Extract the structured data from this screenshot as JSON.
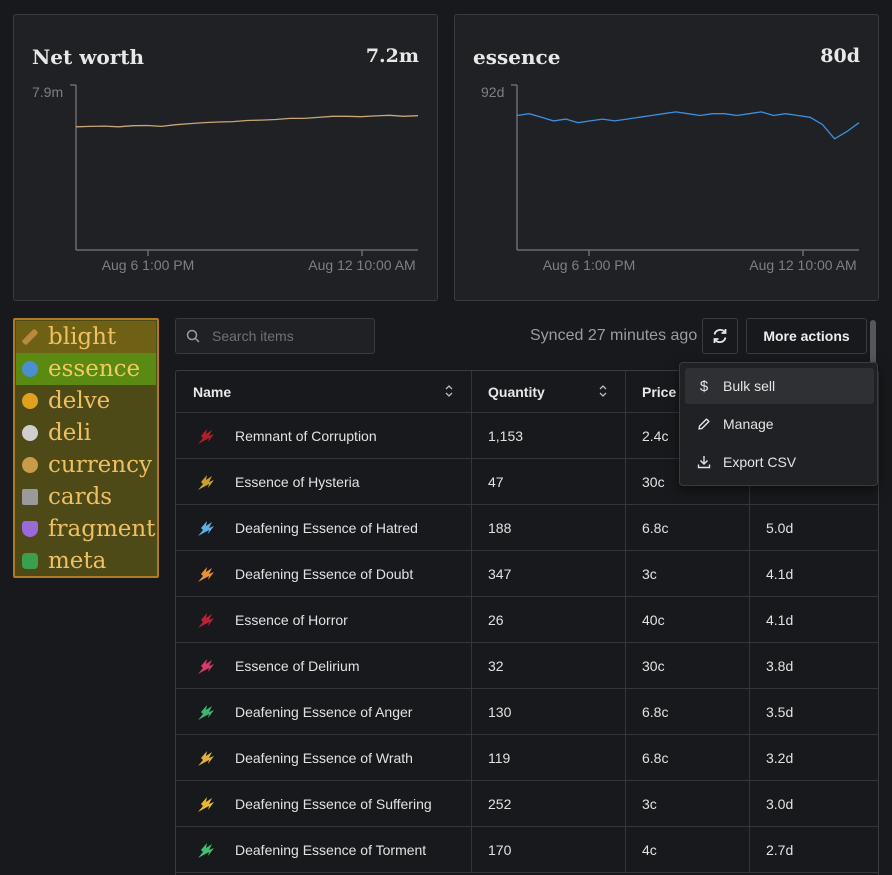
{
  "charts": {
    "networth": {
      "title": "Net worth",
      "value": "7.2m",
      "ytick": "7.9m",
      "xticks": [
        "Aug 6 1:00 PM",
        "Aug 12 10:00 AM"
      ],
      "line_color": "#c9a57a"
    },
    "essence": {
      "title": "essence",
      "value": "80d",
      "ytick": "92d",
      "xticks": [
        "Aug 6 1:00 PM",
        "Aug 12 10:00 AM"
      ],
      "line_color": "#3d8fe0"
    }
  },
  "chart_data": [
    {
      "type": "line",
      "title": "Net worth",
      "ylabel": "",
      "x_ticks": [
        "Aug 6 1:00 PM",
        "Aug 12 10:00 AM"
      ],
      "y_ticks": [
        "7.9m"
      ],
      "ylim": [
        0,
        7.9
      ],
      "series": [
        {
          "values": [
            5.9,
            5.92,
            5.93,
            5.9,
            5.95,
            5.96,
            5.92,
            6.0,
            6.05,
            6.1,
            6.13,
            6.15,
            6.2,
            6.22,
            6.25,
            6.3,
            6.3,
            6.35,
            6.4,
            6.4,
            6.38,
            6.42,
            6.45,
            6.4,
            6.43
          ]
        }
      ]
    },
    {
      "type": "line",
      "title": "essence",
      "ylabel": "",
      "x_ticks": [
        "Aug 6 1:00 PM",
        "Aug 12 10:00 AM"
      ],
      "y_ticks": [
        "92d"
      ],
      "ylim": [
        0,
        92
      ],
      "series": [
        {
          "values": [
            75,
            76,
            74,
            72,
            73,
            71,
            72,
            73,
            72,
            73,
            74,
            75,
            76,
            77,
            76,
            75,
            76,
            76,
            75,
            76,
            77,
            75,
            76,
            75,
            74,
            70,
            62,
            66,
            71
          ]
        }
      ]
    }
  ],
  "categories": [
    {
      "label": "blight",
      "color": "#b88a3a"
    },
    {
      "label": "essence",
      "color": "#4a8fd0"
    },
    {
      "label": "delve",
      "color": "#e0a020"
    },
    {
      "label": "deli",
      "color": "#cfcfcf"
    },
    {
      "label": "currency",
      "color": "#c99a4a"
    },
    {
      "label": "cards",
      "color": "#9a9a9a"
    },
    {
      "label": "fragment",
      "color": "#9b6ad8"
    },
    {
      "label": "meta",
      "color": "#3aa050"
    }
  ],
  "toolbar": {
    "search_placeholder": "Search items",
    "synced": "Synced 27 minutes ago",
    "more_actions": "More actions"
  },
  "menu": {
    "bulk_sell": "Bulk sell",
    "manage": "Manage",
    "export_csv": "Export CSV"
  },
  "table": {
    "headers": {
      "name": "Name",
      "quantity": "Quantity",
      "price": "Price"
    },
    "rows": [
      {
        "name": "Remnant of Corruption",
        "qty": "1,153",
        "price": "2.4c",
        "value": "",
        "color": "#b0202a"
      },
      {
        "name": "Essence of Hysteria",
        "qty": "47",
        "price": "30c",
        "value": "",
        "color": "#c8a030"
      },
      {
        "name": "Deafening Essence of Hatred",
        "qty": "188",
        "price": "6.8c",
        "value": "5.0d",
        "color": "#60b0e8"
      },
      {
        "name": "Deafening Essence of Doubt",
        "qty": "347",
        "price": "3c",
        "value": "4.1d",
        "color": "#e8903a"
      },
      {
        "name": "Essence of Horror",
        "qty": "26",
        "price": "40c",
        "value": "4.1d",
        "color": "#c02035"
      },
      {
        "name": "Essence of Delirium",
        "qty": "32",
        "price": "30c",
        "value": "3.8d",
        "color": "#d83a6a"
      },
      {
        "name": "Deafening Essence of Anger",
        "qty": "130",
        "price": "6.8c",
        "value": "3.5d",
        "color": "#3ab870"
      },
      {
        "name": "Deafening Essence of Wrath",
        "qty": "119",
        "price": "6.8c",
        "value": "3.2d",
        "color": "#e0b040"
      },
      {
        "name": "Deafening Essence of Suffering",
        "qty": "252",
        "price": "3c",
        "value": "3.0d",
        "color": "#e8b830"
      },
      {
        "name": "Deafening Essence of Torment",
        "qty": "170",
        "price": "4c",
        "value": "2.7d",
        "color": "#40c070"
      }
    ]
  }
}
